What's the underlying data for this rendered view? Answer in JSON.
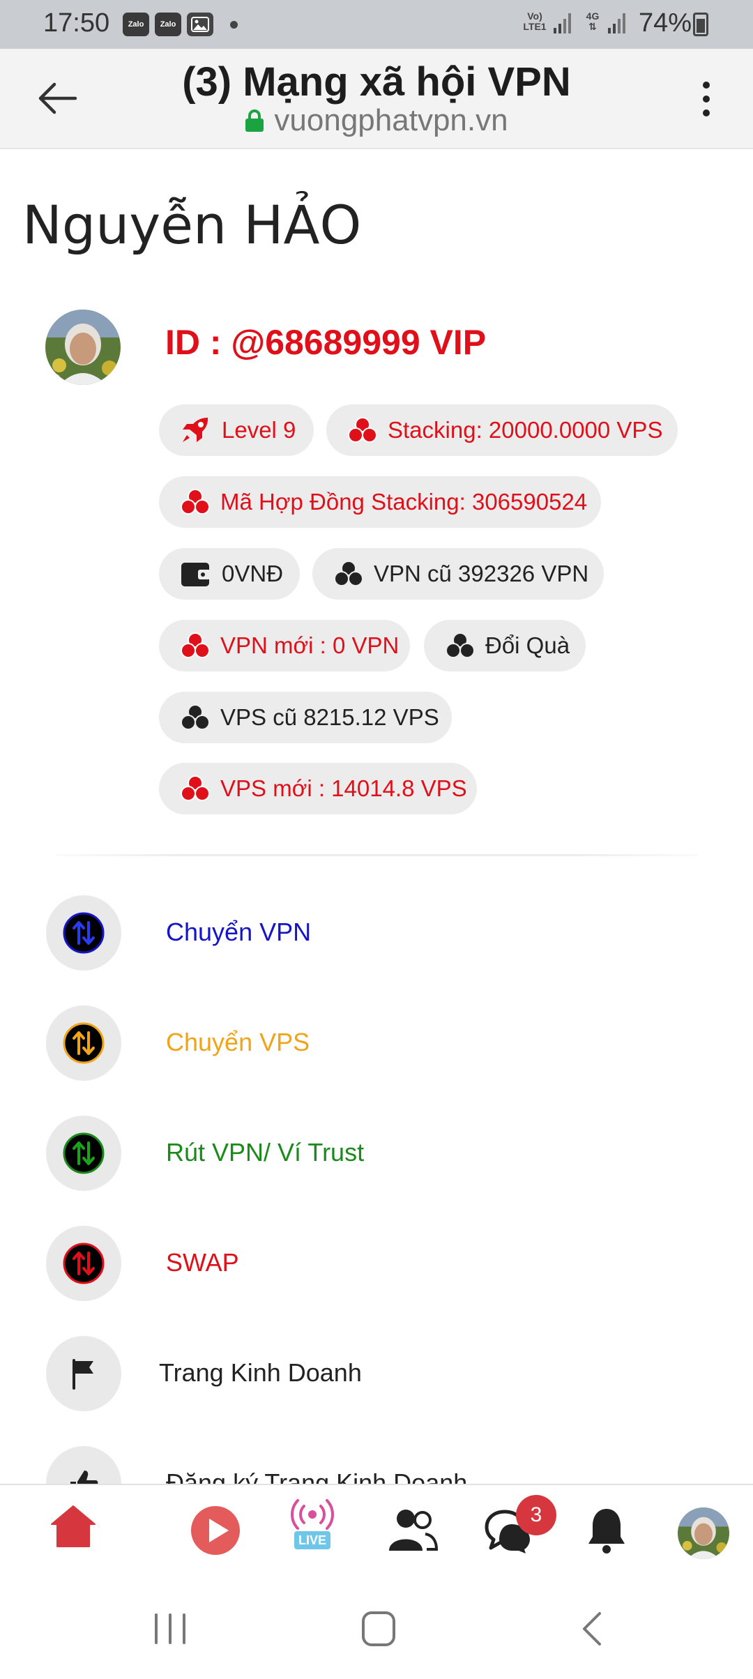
{
  "status_bar": {
    "time": "17:50",
    "notification_icons": [
      "Zalo",
      "Zalo",
      "image-icon"
    ],
    "network_1": "Vo) LTE1",
    "network_2": "4G",
    "battery": "74%"
  },
  "browser": {
    "title": "(3) Mạng xã hội VPN",
    "url": "vuongphatvpn.vn",
    "secure_color": "#1aa340"
  },
  "profile": {
    "name": "Nguyễn HẢO",
    "id_text": "ID : @68689999 VIP"
  },
  "chips": [
    {
      "label": "Level 9",
      "icon": "rocket-icon",
      "color": "red"
    },
    {
      "label": "Stacking: 20000.0000 VPS",
      "icon": "coins-icon",
      "color": "red"
    },
    {
      "label": "Mã Hợp Đồng Stacking: 306590524",
      "icon": "coins-icon",
      "color": "red"
    },
    {
      "label": "0VNĐ",
      "icon": "wallet-icon",
      "color": "dark"
    },
    {
      "label": "VPN cũ 392326 VPN",
      "icon": "coins-icon",
      "color": "dark"
    },
    {
      "label": "VPN mới : 0 VPN",
      "icon": "coins-icon",
      "color": "red"
    },
    {
      "label": "Đổi Quà",
      "icon": "coins-icon",
      "color": "dark"
    },
    {
      "label": "VPS cũ 8215.12 VPS",
      "icon": "coins-icon",
      "color": "dark"
    },
    {
      "label": "VPS mới : 14014.8 VPS",
      "icon": "coins-icon",
      "color": "red"
    }
  ],
  "menu": [
    {
      "label": "Chuyển VPN",
      "icon": "transfer-icon",
      "color": "#1414c8"
    },
    {
      "label": "Chuyển VPS",
      "icon": "transfer-icon",
      "color": "#f0a418"
    },
    {
      "label": "Rút VPN/ Ví Trust",
      "icon": "transfer-icon",
      "color": "#1a8a1a"
    },
    {
      "label": "SWAP",
      "icon": "transfer-icon",
      "color": "#e0101a"
    },
    {
      "label": "Trang Kinh Doanh",
      "icon": "flag-icon",
      "color": "#222222"
    },
    {
      "label": "Đăng ký Trang Kinh Doanh",
      "icon": "thumb-icon",
      "color": "#222222"
    }
  ],
  "bottom_nav": {
    "live_label": "LIVE",
    "messages_badge": "3",
    "accent": "#d6363d"
  }
}
